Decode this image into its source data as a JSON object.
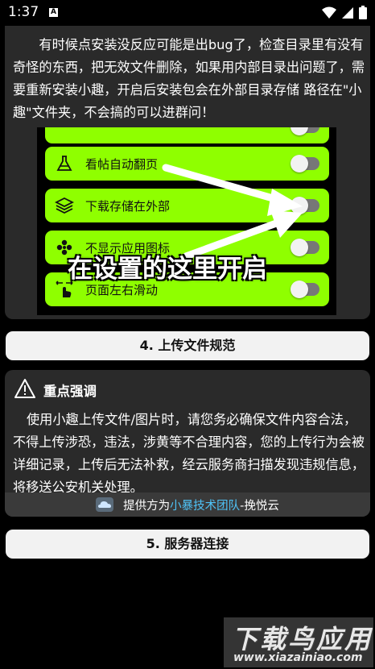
{
  "status_bar": {
    "time": "1:37",
    "notification_letter": "A"
  },
  "intro_text": "有时候点安装没反应可能是出bug了，检查目录里有没有奇怪的东西，把无效文件删除，如果用内部目录出问题了，需要重新安装小趣，开启后安装包会在外部目录存储 路径在\"小趣\"文件夹，不会搞的可以进群问！",
  "screenshot": {
    "rows": [
      {
        "label": "看帖自动翻页",
        "icon": "flask-icon"
      },
      {
        "label": "下载存储在外部",
        "icon": "layers-icon"
      },
      {
        "label": "不显示应用图标",
        "icon": "flower-icon"
      },
      {
        "label": "页面左右滑动",
        "icon": "swipe-hand-icon"
      }
    ],
    "caption": "在设置的这里开启",
    "accent": "#8fff00"
  },
  "sections": {
    "upload_rules": "4. 上传文件规范",
    "server_connect": "5. 服务器连接"
  },
  "notice": {
    "title": "重点强调",
    "body": "使用小趣上传文件/图片时，请您务必确保文件内容合法，不得上传涉恐，违法，涉黄等不合理内容，您的上传行为会被详细记录，上传后无法补救，经云服务商扫描发现违规信息，将移送公安机关处理。",
    "footer_prefix": "提供方为",
    "footer_link": "小暴技术团队",
    "footer_suffix": "-挽悦云"
  },
  "watermark": {
    "main": "下载鸟应用",
    "url": "www.xiazainiao.com"
  }
}
